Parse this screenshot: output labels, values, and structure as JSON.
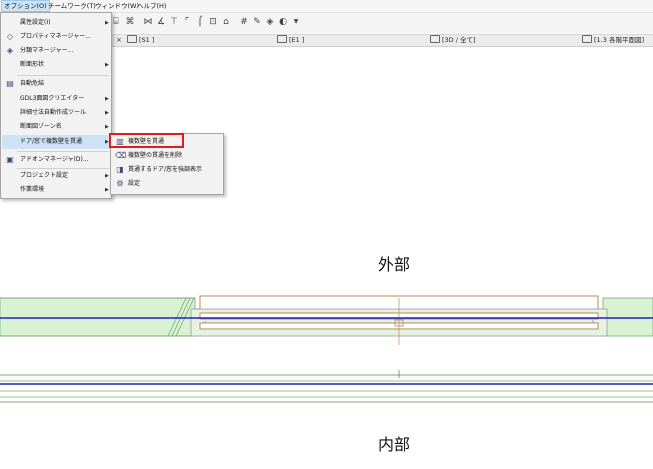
{
  "menubar": {
    "items": [
      "オプション(O)",
      "チームワーク(T)",
      "ウィンドウ(W)",
      "ヘルプ(H)"
    ]
  },
  "tabs": {
    "close": "×",
    "items": [
      "[S1 ]",
      "[E1 ]",
      "[3D / 全て]",
      "[1.3 各階平面図]"
    ]
  },
  "options_menu": {
    "items": [
      {
        "label": "属性設定(I)",
        "icon": "",
        "submenu": true
      },
      {
        "label": "プロパティマネージャー...",
        "icon": "tag-icon",
        "submenu": false
      },
      {
        "label": "分類マネージャー...",
        "icon": "classification-icon",
        "submenu": false
      },
      {
        "label": "断面形状",
        "icon": "",
        "submenu": true
      },
      {
        "label": "自動危結",
        "icon": "auto-connect-icon",
        "submenu": false
      },
      {
        "label": "GDL3面図クリエイター",
        "icon": "",
        "submenu": true
      },
      {
        "label": "詳細寸法自動作成ツール",
        "icon": "",
        "submenu": true
      },
      {
        "label": "断面図ゾーン名",
        "icon": "",
        "submenu": true
      },
      {
        "label": "ドア/窓で複数壁を貫通",
        "icon": "",
        "submenu": true
      },
      {
        "label": "アドオンマネージャ(D)...",
        "icon": "addon-icon",
        "submenu": false
      },
      {
        "label": "プロジェクト設定",
        "icon": "",
        "submenu": true
      },
      {
        "label": "作業環境",
        "icon": "",
        "submenu": true
      }
    ]
  },
  "submenu": {
    "items": [
      {
        "label": "複数壁を貫通",
        "icon": "pierce-walls-icon"
      },
      {
        "label": "複数壁の貫通を削除",
        "icon": "remove-pierce-icon"
      },
      {
        "label": "貫通するドア/窓を強調表示",
        "icon": "highlight-icon"
      },
      {
        "label": "設定",
        "icon": "settings-gear-icon"
      }
    ]
  },
  "canvas": {
    "exterior_label": "外部",
    "interior_label": "内部"
  },
  "colors": {
    "wall_fill": "#d9f2d2",
    "wall_line": "#8fb98a",
    "blue_line": "#1c24c7",
    "door_line": "#b98a57",
    "highlight": "#cde2f5",
    "red_box": "#e01c1c"
  }
}
